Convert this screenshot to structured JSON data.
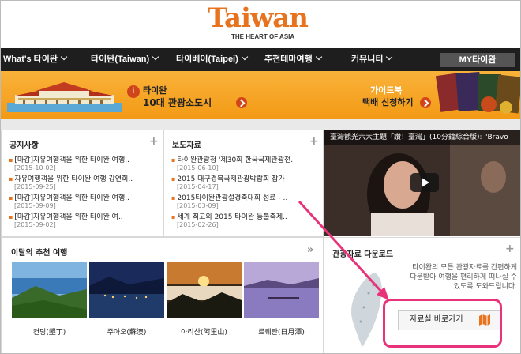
{
  "header": {
    "logo": "Taiwan",
    "tagline": "THE HEART OF ASIA"
  },
  "nav": {
    "items": [
      {
        "label": "What's 타이완"
      },
      {
        "label": "타이완(Taiwan)"
      },
      {
        "label": "타이베이(Taipei)"
      },
      {
        "label": "추천테마여행"
      },
      {
        "label": "커뮤니티"
      }
    ],
    "my_button": "MY타이완"
  },
  "banner": {
    "left_title": "타이완",
    "left_subtitle": "10대 관광소도시",
    "right_title": "가이드북",
    "right_subtitle": "택배 신청하기"
  },
  "notices": {
    "title": "공지사항",
    "items": [
      {
        "title": "[마감]자유여행객을 위한 타이완 여행..",
        "date": "[2015-10-02]"
      },
      {
        "title": "자유여행객을 위한 타이완 여행 강연회..",
        "date": "[2015-09-25]"
      },
      {
        "title": "[마감]자유여행객을 위한 타이완 여행..",
        "date": "[2015-09-09]"
      },
      {
        "title": "[마감]자유여행객을 위한 타이완 여..",
        "date": "[2015-09-02]"
      }
    ]
  },
  "press": {
    "title": "보도자료",
    "items": [
      {
        "title": "타이완관광청 '제30회 한국국제관광전..",
        "date": "[2015-06-10]"
      },
      {
        "title": "2015 대구경북국제관광박람회 참가",
        "date": "[2015-04-17]"
      },
      {
        "title": "2015타이완관광설경축대회 성료 - ..",
        "date": "[2015-03-09]"
      },
      {
        "title": "세계 최고의 2015 타이완 등불축제..",
        "date": "[2015-02-26]"
      }
    ]
  },
  "video": {
    "title": "臺灣觀光六大主題「讚！臺灣」(10分鐘綜合版): \"Bravo"
  },
  "recommended": {
    "title": "이달의 추천 여행",
    "places": [
      {
        "name": "컨딩(墾丁)"
      },
      {
        "name": "주아오(蘇澳)"
      },
      {
        "name": "아리산(阿里山)"
      },
      {
        "name": "르웨탄(日月潭)"
      }
    ]
  },
  "download": {
    "title": "관광자료 다운로드",
    "description_lines": [
      "타이완의 모든 관광자료를 간편하게",
      "다운받아 여행을 편리하게 떠나실 수",
      "있도록 도와드립니다."
    ],
    "button_label": "자료실 바로가기"
  },
  "colors": {
    "brand": "#e8731e",
    "nav_bg": "#1e1e1e",
    "banner": "#f7a623",
    "highlight": "#e8327a"
  }
}
